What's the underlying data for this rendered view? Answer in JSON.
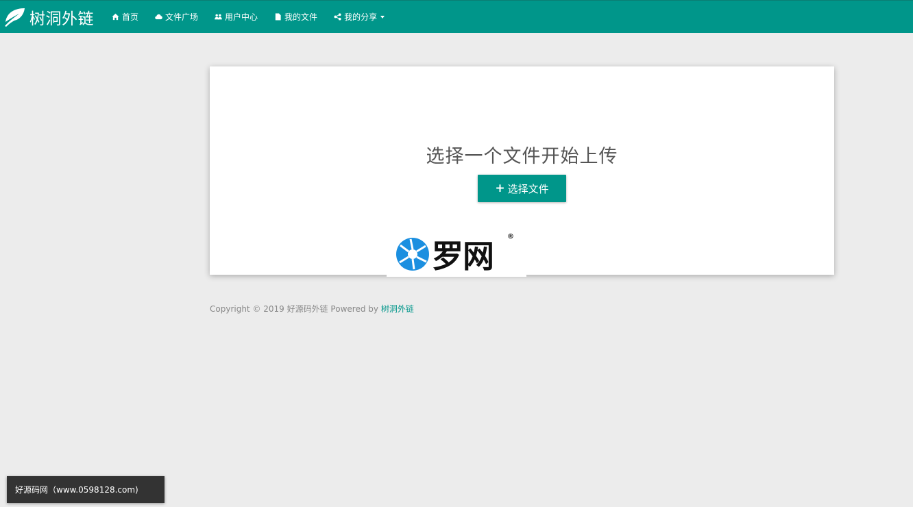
{
  "navbar": {
    "brand": "树洞外链",
    "items": [
      {
        "label": "首页",
        "icon": "home-icon"
      },
      {
        "label": "文件广场",
        "icon": "cloud-icon"
      },
      {
        "label": "用户中心",
        "icon": "users-icon"
      },
      {
        "label": "我的文件",
        "icon": "file-icon"
      },
      {
        "label": "我的分享",
        "icon": "share-icon",
        "dropdown": true
      }
    ]
  },
  "upload": {
    "title": "选择一个文件开始上传",
    "button_label": "选择文件"
  },
  "watermark": {
    "text": "罗网",
    "reg": "®"
  },
  "footer": {
    "prefix": "Copyright © 2019 好源码外链 Powered by ",
    "link": "树洞外链"
  },
  "toast": {
    "text": "好源码网（www.0598128.com)"
  },
  "colors": {
    "primary": "#00968a",
    "background": "#ececec"
  }
}
